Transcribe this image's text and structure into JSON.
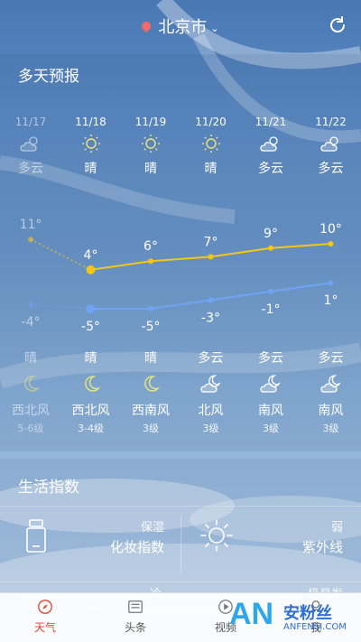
{
  "header": {
    "city": "北京市"
  },
  "forecast": {
    "title": "多天预报",
    "days": [
      {
        "date": "11/17",
        "day_weather": "多云",
        "day_icon": "partly-cloudy-icon",
        "night_weather": "晴",
        "night_icon": "moon-icon",
        "wind": "西北风",
        "wind_level": "5-6级",
        "high": "11°",
        "low": "-4°",
        "past": true
      },
      {
        "date": "11/18",
        "day_weather": "晴",
        "day_icon": "sun-icon",
        "night_weather": "晴",
        "night_icon": "moon-icon",
        "wind": "西北风",
        "wind_level": "3-4级",
        "high": "4°",
        "low": "-5°",
        "past": false
      },
      {
        "date": "11/19",
        "day_weather": "晴",
        "day_icon": "sun-icon",
        "night_weather": "晴",
        "night_icon": "moon-icon",
        "wind": "西南风",
        "wind_level": "3级",
        "high": "6°",
        "low": "-5°",
        "past": false
      },
      {
        "date": "11/20",
        "day_weather": "晴",
        "day_icon": "sun-icon",
        "night_weather": "多云",
        "night_icon": "cloudy-moon-icon",
        "wind": "北风",
        "wind_level": "3级",
        "high": "7°",
        "low": "-3°",
        "past": false
      },
      {
        "date": "11/21",
        "day_weather": "多云",
        "day_icon": "partly-cloudy-icon",
        "night_weather": "多云",
        "night_icon": "cloudy-moon-icon",
        "wind": "南风",
        "wind_level": "3级",
        "high": "9°",
        "low": "-1°",
        "past": false
      },
      {
        "date": "11/22",
        "day_weather": "多云",
        "day_icon": "partly-cloudy-icon",
        "night_weather": "多云",
        "night_icon": "cloudy-moon-icon",
        "wind": "南风",
        "wind_level": "3级",
        "high": "10°",
        "low": "1°",
        "past": false
      }
    ],
    "chart_data": {
      "type": "line",
      "x": [
        "11/17",
        "11/18",
        "11/19",
        "11/20",
        "11/21",
        "11/22"
      ],
      "series": [
        {
          "values": [
            11,
            4,
            6,
            7,
            9,
            10
          ],
          "color": "#f5c518"
        },
        {
          "values": [
            -4,
            -5,
            -5,
            -3,
            -1,
            1
          ],
          "color": "#6fa4f2"
        }
      ]
    }
  },
  "life": {
    "title": "生活指数",
    "items": [
      {
        "label": "保湿",
        "name": "化妆指数",
        "icon": "bottle-icon"
      },
      {
        "label": "弱",
        "name": "紫外线",
        "icon": "sun-outline-icon"
      },
      {
        "label": "冷",
        "icon": "clothing-icon"
      },
      {
        "label": "极易发",
        "icon": "flu-icon"
      }
    ]
  },
  "tabs": [
    {
      "label": "天气",
      "icon": "compass-icon",
      "active": true
    },
    {
      "label": "头条",
      "icon": "news-icon",
      "active": false
    },
    {
      "label": "视频",
      "icon": "play-icon",
      "active": false
    },
    {
      "label": "我",
      "icon": "user-icon",
      "active": false
    }
  ],
  "watermark": {
    "brand": "AN",
    "text": "安粉丝",
    "site": "ANFENSI.COM"
  },
  "colors": {
    "high_line": "#f5c518",
    "low_line": "#6fa4f2",
    "active_tab": "#e8412c"
  }
}
